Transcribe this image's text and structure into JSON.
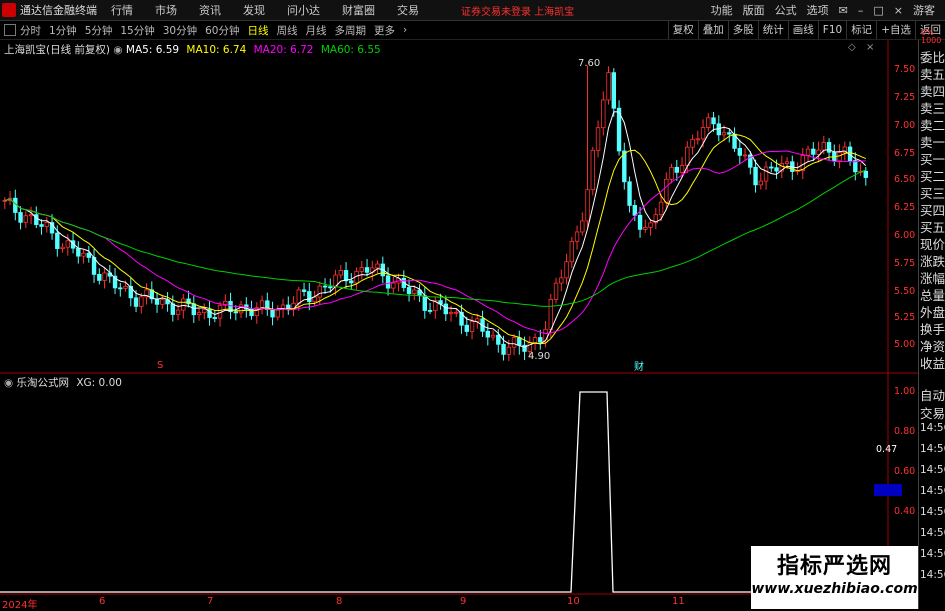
{
  "menubar": {
    "app_name": "通达信金融终端",
    "items": [
      "行情",
      "市场",
      "资讯",
      "发现",
      "问小达",
      "财富圈",
      "交易"
    ],
    "notice": "证券交易未登录  上海凯宝",
    "right_items": [
      "功能",
      "版面",
      "公式",
      "选项"
    ],
    "user": "游客"
  },
  "periodbar": {
    "periods": [
      "分时",
      "1分钟",
      "5分钟",
      "15分钟",
      "30分钟",
      "60分钟",
      "日线",
      "周线",
      "月线",
      "多周期",
      "更多"
    ],
    "active": "日线",
    "tools": [
      "复权",
      "叠加",
      "多股",
      "统计",
      "画线",
      "F10",
      "标记",
      "+自选",
      "返回"
    ]
  },
  "main_header": {
    "stock": "上海凯宝(日线 前复权)",
    "ma5": "MA5: 6.59",
    "ma10": "MA10: 6.74",
    "ma20": "MA20: 6.72",
    "ma60": "MA60: 6.55"
  },
  "sub_header": {
    "name": "乐淘公式网",
    "xg": "XG: 0.00"
  },
  "price_axis": [
    "7.50",
    "7.25",
    "7.00",
    "6.75",
    "6.50",
    "6.25",
    "6.00",
    "5.75",
    "5.50",
    "5.25",
    "5.00"
  ],
  "sub_axis": [
    "1.00",
    "0.80",
    "0.60",
    "0.40",
    "0.20"
  ],
  "sub_cursor": "0.47",
  "annotations": {
    "high": "7.60",
    "low": "4.90",
    "mark_s": "S",
    "mark_cai": "财"
  },
  "date_axis": [
    "2024年",
    "6",
    "7",
    "8",
    "9",
    "10",
    "11"
  ],
  "side_panel": {
    "items": [
      "委比",
      "卖五",
      "卖四",
      "卖三",
      "卖二",
      "卖一",
      "买一",
      "买二",
      "买三",
      "买四",
      "买五",
      "现价",
      "涨跌",
      "涨幅",
      "总量",
      "外盘",
      "换手",
      "净资",
      "收益"
    ],
    "lower": [
      "自动",
      "交易"
    ],
    "times": [
      "14:56",
      "14:56",
      "14:56",
      "14:56",
      "14:56",
      "14:56",
      "14:56",
      "14:56"
    ],
    "top_label": "0%",
    "top_num": "1000"
  },
  "colors": {
    "up": "#ff3030",
    "down": "#54ffff",
    "ma5": "#ffffff",
    "ma10": "#ffff00",
    "ma20": "#ff00ff",
    "ma60": "#00d000"
  },
  "watermark": {
    "title": "指标严选网",
    "url": "www.xuezhibiao.com"
  },
  "chart_data": {
    "type": "candlestick",
    "series_close_approx": [
      6.3,
      6.2,
      6.05,
      5.9,
      5.75,
      5.55,
      5.45,
      5.4,
      5.35,
      5.3,
      5.3,
      5.35,
      5.3,
      5.35,
      5.45,
      5.55,
      5.65,
      5.7,
      5.6,
      5.45,
      5.35,
      5.25,
      5.15,
      5.0,
      4.95,
      5.1,
      5.75,
      6.3,
      7.6,
      6.2,
      6.1,
      6.6,
      6.9,
      7.1,
      6.8,
      6.55,
      6.65,
      6.7,
      6.85,
      6.75,
      6.55
    ],
    "ylim": [
      4.85,
      7.65
    ],
    "sub_indicator": {
      "name": "XG",
      "values": [
        0,
        1,
        0
      ],
      "ylim": [
        0,
        1
      ]
    }
  }
}
